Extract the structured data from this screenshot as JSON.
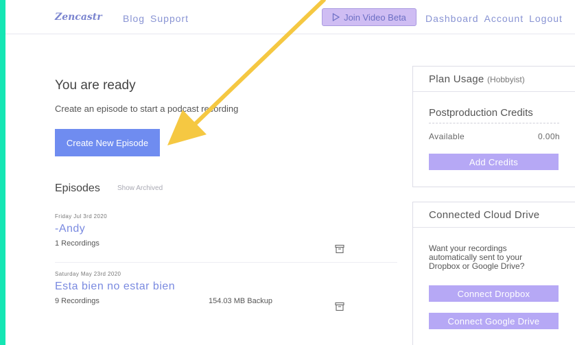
{
  "header": {
    "logo": "Zencastr",
    "nav_left": [
      "Blog",
      "Support"
    ],
    "video_beta": "Join Video Beta",
    "nav_right": [
      "Dashboard",
      "Account",
      "Logout"
    ]
  },
  "main": {
    "title": "You are ready",
    "subtitle": "Create an episode to start a podcast recording",
    "create_button": "Create New Episode",
    "episodes_title": "Episodes",
    "show_archived": "Show Archived",
    "episodes": [
      {
        "date": "Friday Jul 3rd 2020",
        "name": "-Andy",
        "recordings": "1 Recordings",
        "backup": ""
      },
      {
        "date": "Saturday May 23rd 2020",
        "name": "Esta bien no estar bien",
        "recordings": "9 Recordings",
        "backup": "154.03 MB Backup"
      }
    ]
  },
  "plan": {
    "title": "Plan Usage",
    "plan_name": "(Hobbyist)",
    "credits_title": "Postproduction Credits",
    "available_label": "Available",
    "available_value": "0.00h",
    "add_credits": "Add Credits"
  },
  "cloud": {
    "title": "Connected Cloud Drive",
    "description": "Want your recordings automatically sent to your Dropbox or Google Drive?",
    "dropbox_button": "Connect Dropbox",
    "gdrive_button": "Connect Google Drive"
  },
  "colors": {
    "background_border": "#15e6b4",
    "primary_button": "#6f8cf0",
    "purple_button": "#b6a8f5",
    "link": "#7a8ae0",
    "arrow": "#f5c842"
  }
}
